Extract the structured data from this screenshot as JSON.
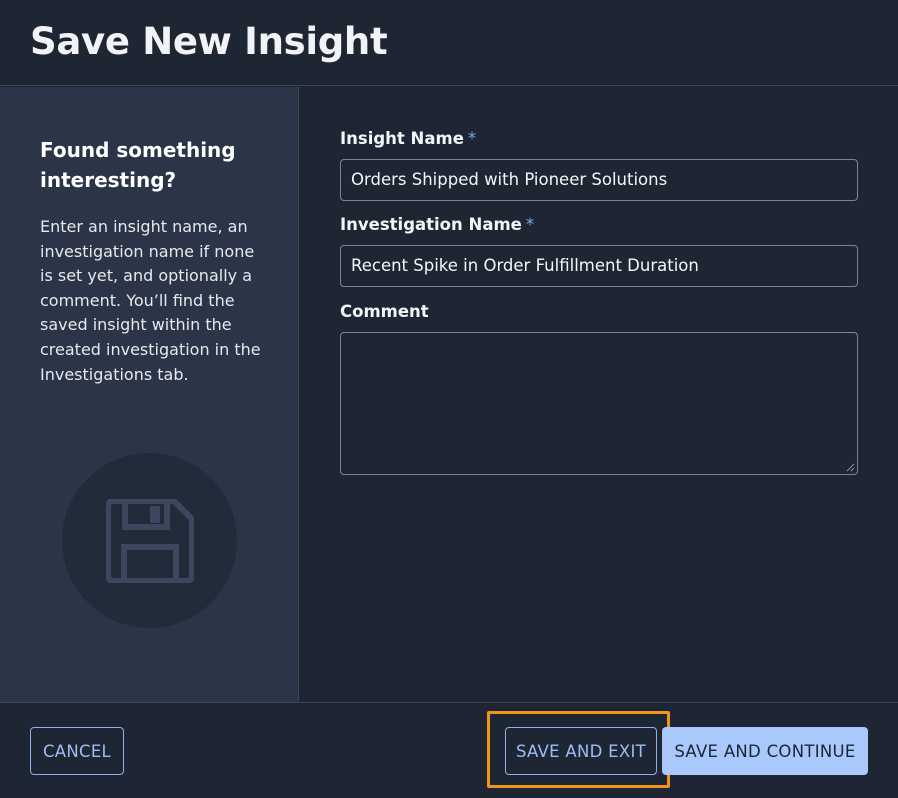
{
  "dialog": {
    "title": "Save New Insight"
  },
  "sidebar": {
    "heading": "Found something interesting?",
    "description": "Enter an insight name, an investigation name if none is set yet, and optionally a comment. You’ll find the saved insight within the created investigation in the Investigations tab.",
    "icon": "floppy-disk-icon"
  },
  "form": {
    "required_marker": "*",
    "insight_name": {
      "label": "Insight Name",
      "value": "Orders Shipped with Pioneer Solutions"
    },
    "investigation_name": {
      "label": "Investigation Name",
      "value": "Recent Spike in Order Fulfillment Duration"
    },
    "comment": {
      "label": "Comment",
      "value": ""
    }
  },
  "footer": {
    "cancel_label": "CANCEL",
    "save_exit_label": "SAVE AND EXIT",
    "save_continue_label": "SAVE AND CONTINUE"
  },
  "colors": {
    "background": "#1f2633",
    "sidebar": "#2b3547",
    "accent": "#a9c8fb",
    "highlight": "#f0951a"
  }
}
